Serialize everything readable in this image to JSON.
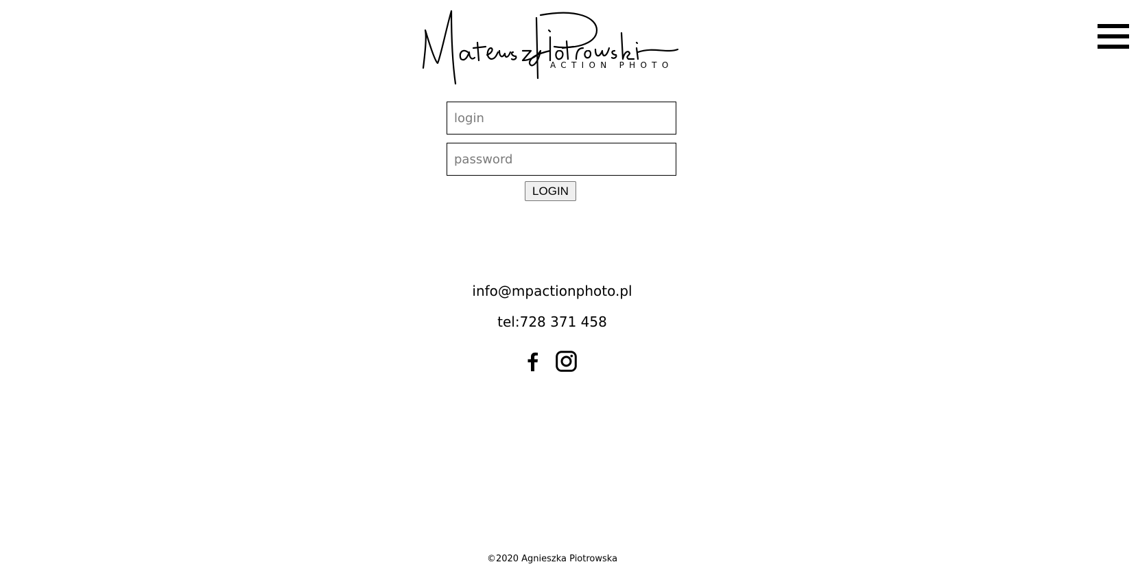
{
  "logo": {
    "name": "Mateusz Piotrowski",
    "tagline": "ACTION PHOTO"
  },
  "menu": {
    "icon": "hamburger-menu-icon"
  },
  "form": {
    "login_placeholder": "login",
    "password_placeholder": "password",
    "submit_label": "LOGIN"
  },
  "contact": {
    "email": "info@mpactionphoto.pl",
    "phone": "tel:728 371 458"
  },
  "social": [
    {
      "icon": "facebook-icon"
    },
    {
      "icon": "instagram-icon"
    }
  ],
  "footer": {
    "copyright": "©2020 Agnieszka Piotrowska"
  }
}
